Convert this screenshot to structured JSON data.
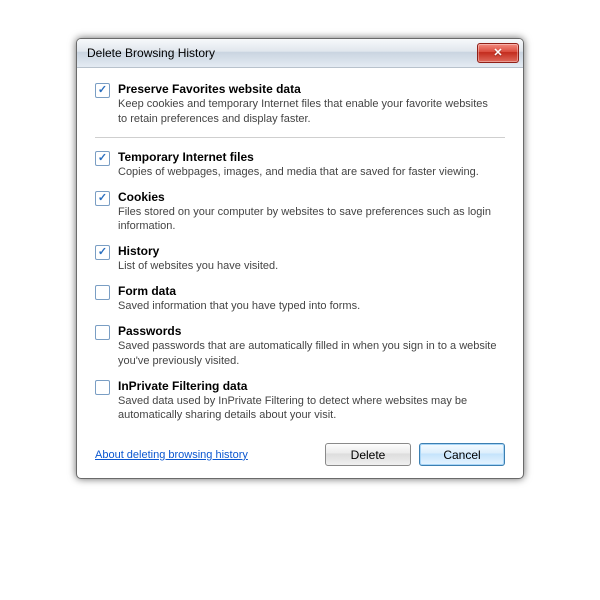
{
  "dialog": {
    "title": "Delete Browsing History",
    "entries": [
      {
        "checked": true,
        "label": "Preserve Favorites website data",
        "desc": "Keep cookies and temporary Internet files that enable your favorite websites to retain preferences and display faster."
      },
      {
        "checked": true,
        "label": "Temporary Internet files",
        "desc": "Copies of webpages, images, and media that are saved for faster viewing."
      },
      {
        "checked": true,
        "label": "Cookies",
        "desc": "Files stored on your computer by websites to save preferences such as login information."
      },
      {
        "checked": true,
        "label": "History",
        "desc": "List of websites you have visited."
      },
      {
        "checked": false,
        "label": "Form data",
        "desc": "Saved information that you have typed into forms."
      },
      {
        "checked": false,
        "label": "Passwords",
        "desc": "Saved passwords that are automatically filled in when you sign in to a website you've previously visited."
      },
      {
        "checked": false,
        "label": "InPrivate Filtering data",
        "desc": "Saved data used by InPrivate Filtering to detect where websites may be automatically sharing details about your visit."
      }
    ],
    "divider_after_index": 0,
    "link": "About deleting browsing history",
    "delete_button": "Delete",
    "cancel_button": "Cancel"
  }
}
